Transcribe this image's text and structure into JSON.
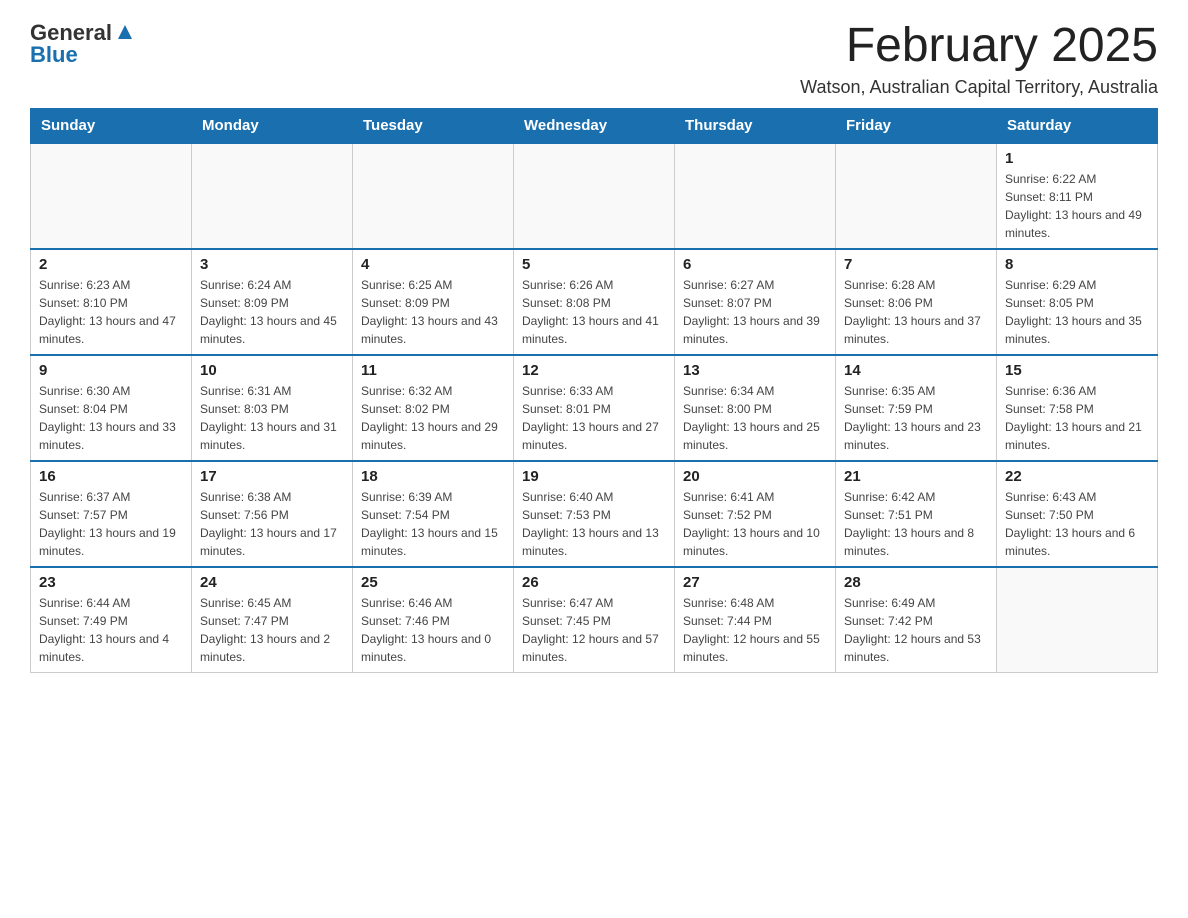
{
  "logo": {
    "general": "General",
    "blue": "Blue"
  },
  "title": "February 2025",
  "subtitle": "Watson, Australian Capital Territory, Australia",
  "weekdays": [
    "Sunday",
    "Monday",
    "Tuesday",
    "Wednesday",
    "Thursday",
    "Friday",
    "Saturday"
  ],
  "weeks": [
    [
      {
        "day": "",
        "info": ""
      },
      {
        "day": "",
        "info": ""
      },
      {
        "day": "",
        "info": ""
      },
      {
        "day": "",
        "info": ""
      },
      {
        "day": "",
        "info": ""
      },
      {
        "day": "",
        "info": ""
      },
      {
        "day": "1",
        "info": "Sunrise: 6:22 AM\nSunset: 8:11 PM\nDaylight: 13 hours and 49 minutes."
      }
    ],
    [
      {
        "day": "2",
        "info": "Sunrise: 6:23 AM\nSunset: 8:10 PM\nDaylight: 13 hours and 47 minutes."
      },
      {
        "day": "3",
        "info": "Sunrise: 6:24 AM\nSunset: 8:09 PM\nDaylight: 13 hours and 45 minutes."
      },
      {
        "day": "4",
        "info": "Sunrise: 6:25 AM\nSunset: 8:09 PM\nDaylight: 13 hours and 43 minutes."
      },
      {
        "day": "5",
        "info": "Sunrise: 6:26 AM\nSunset: 8:08 PM\nDaylight: 13 hours and 41 minutes."
      },
      {
        "day": "6",
        "info": "Sunrise: 6:27 AM\nSunset: 8:07 PM\nDaylight: 13 hours and 39 minutes."
      },
      {
        "day": "7",
        "info": "Sunrise: 6:28 AM\nSunset: 8:06 PM\nDaylight: 13 hours and 37 minutes."
      },
      {
        "day": "8",
        "info": "Sunrise: 6:29 AM\nSunset: 8:05 PM\nDaylight: 13 hours and 35 minutes."
      }
    ],
    [
      {
        "day": "9",
        "info": "Sunrise: 6:30 AM\nSunset: 8:04 PM\nDaylight: 13 hours and 33 minutes."
      },
      {
        "day": "10",
        "info": "Sunrise: 6:31 AM\nSunset: 8:03 PM\nDaylight: 13 hours and 31 minutes."
      },
      {
        "day": "11",
        "info": "Sunrise: 6:32 AM\nSunset: 8:02 PM\nDaylight: 13 hours and 29 minutes."
      },
      {
        "day": "12",
        "info": "Sunrise: 6:33 AM\nSunset: 8:01 PM\nDaylight: 13 hours and 27 minutes."
      },
      {
        "day": "13",
        "info": "Sunrise: 6:34 AM\nSunset: 8:00 PM\nDaylight: 13 hours and 25 minutes."
      },
      {
        "day": "14",
        "info": "Sunrise: 6:35 AM\nSunset: 7:59 PM\nDaylight: 13 hours and 23 minutes."
      },
      {
        "day": "15",
        "info": "Sunrise: 6:36 AM\nSunset: 7:58 PM\nDaylight: 13 hours and 21 minutes."
      }
    ],
    [
      {
        "day": "16",
        "info": "Sunrise: 6:37 AM\nSunset: 7:57 PM\nDaylight: 13 hours and 19 minutes."
      },
      {
        "day": "17",
        "info": "Sunrise: 6:38 AM\nSunset: 7:56 PM\nDaylight: 13 hours and 17 minutes."
      },
      {
        "day": "18",
        "info": "Sunrise: 6:39 AM\nSunset: 7:54 PM\nDaylight: 13 hours and 15 minutes."
      },
      {
        "day": "19",
        "info": "Sunrise: 6:40 AM\nSunset: 7:53 PM\nDaylight: 13 hours and 13 minutes."
      },
      {
        "day": "20",
        "info": "Sunrise: 6:41 AM\nSunset: 7:52 PM\nDaylight: 13 hours and 10 minutes."
      },
      {
        "day": "21",
        "info": "Sunrise: 6:42 AM\nSunset: 7:51 PM\nDaylight: 13 hours and 8 minutes."
      },
      {
        "day": "22",
        "info": "Sunrise: 6:43 AM\nSunset: 7:50 PM\nDaylight: 13 hours and 6 minutes."
      }
    ],
    [
      {
        "day": "23",
        "info": "Sunrise: 6:44 AM\nSunset: 7:49 PM\nDaylight: 13 hours and 4 minutes."
      },
      {
        "day": "24",
        "info": "Sunrise: 6:45 AM\nSunset: 7:47 PM\nDaylight: 13 hours and 2 minutes."
      },
      {
        "day": "25",
        "info": "Sunrise: 6:46 AM\nSunset: 7:46 PM\nDaylight: 13 hours and 0 minutes."
      },
      {
        "day": "26",
        "info": "Sunrise: 6:47 AM\nSunset: 7:45 PM\nDaylight: 12 hours and 57 minutes."
      },
      {
        "day": "27",
        "info": "Sunrise: 6:48 AM\nSunset: 7:44 PM\nDaylight: 12 hours and 55 minutes."
      },
      {
        "day": "28",
        "info": "Sunrise: 6:49 AM\nSunset: 7:42 PM\nDaylight: 12 hours and 53 minutes."
      },
      {
        "day": "",
        "info": ""
      }
    ]
  ]
}
